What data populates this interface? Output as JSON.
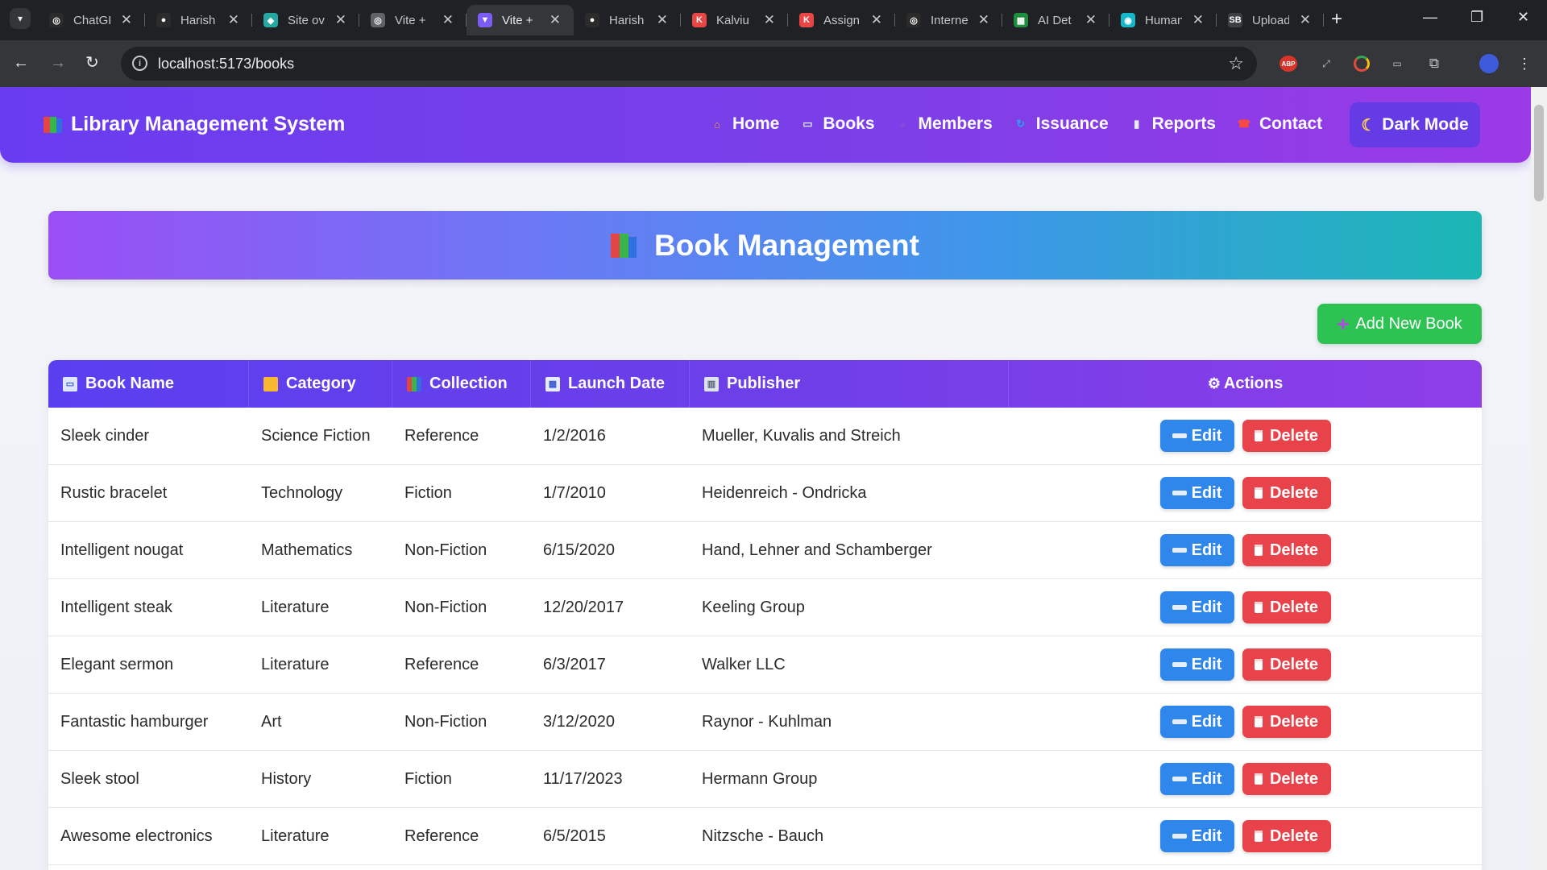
{
  "browser": {
    "tabs": [
      {
        "title": "ChatGPT",
        "favicon": "chatgpt-icon",
        "color": "#2b2b2b",
        "glyph": "◎",
        "active": false
      },
      {
        "title": "Harish",
        "favicon": "github-icon",
        "color": "#2b2b2b",
        "glyph": "●",
        "active": false
      },
      {
        "title": "Site ov",
        "favicon": "netlify-icon",
        "color": "#25a8a0",
        "glyph": "◆",
        "active": false
      },
      {
        "title": "Vite +",
        "favicon": "globe-icon",
        "color": "#5f6368",
        "glyph": "◎",
        "active": false
      },
      {
        "title": "Vite +",
        "favicon": "vite-icon",
        "color": "#7d5cf5",
        "glyph": "▼",
        "active": true
      },
      {
        "title": "Harish",
        "favicon": "github-icon",
        "color": "#2b2b2b",
        "glyph": "●",
        "active": false
      },
      {
        "title": "Kalviu",
        "favicon": "kalvium-icon",
        "color": "#e84545",
        "glyph": "K",
        "active": false
      },
      {
        "title": "Assign",
        "favicon": "kalvium-icon",
        "color": "#e84545",
        "glyph": "K",
        "active": false
      },
      {
        "title": "Interne",
        "favicon": "chatgpt-icon",
        "color": "#2b2b2b",
        "glyph": "◎",
        "active": false
      },
      {
        "title": "AI Det",
        "favicon": "sheets-icon",
        "color": "#1e8e3e",
        "glyph": "▦",
        "active": false
      },
      {
        "title": "Human",
        "favicon": "humanizer-icon",
        "color": "#14b8c8",
        "glyph": "◉",
        "active": false
      },
      {
        "title": "Upload",
        "favicon": "sb-icon",
        "color": "#3c4043",
        "glyph": "SB",
        "active": false
      }
    ],
    "url": "localhost:5173/books"
  },
  "navbar": {
    "brand": "Library Management System",
    "links": [
      {
        "label": "Home",
        "icon": "house-icon",
        "color": "#f29b3a"
      },
      {
        "label": "Books",
        "icon": "open-book-icon",
        "color": "#dfe7ff"
      },
      {
        "label": "Members",
        "icon": "people-icon",
        "color": "#8a4ad8"
      },
      {
        "label": "Issuance",
        "icon": "refresh-icon",
        "color": "#2aa3f0"
      },
      {
        "label": "Reports",
        "icon": "bar-chart-icon",
        "color": "#e8ecf0"
      },
      {
        "label": "Contact",
        "icon": "telephone-icon",
        "color": "#ff4a3a"
      }
    ],
    "dark_mode_label": "Dark Mode"
  },
  "page": {
    "title": "Book Management",
    "add_button_label": "Add New Book"
  },
  "table": {
    "headers": [
      {
        "label": "Book Name",
        "icon": "open-book-icon"
      },
      {
        "label": "Category",
        "icon": "folder-icon"
      },
      {
        "label": "Collection",
        "icon": "books-icon"
      },
      {
        "label": "Launch Date",
        "icon": "calendar-icon"
      },
      {
        "label": "Publisher",
        "icon": "building-icon"
      },
      {
        "label": "Actions",
        "icon": "gear-icon"
      }
    ],
    "edit_label": "Edit",
    "delete_label": "Delete",
    "rows": [
      [
        "Sleek cinder",
        "Science Fiction",
        "Reference",
        "1/2/2016",
        "Mueller, Kuvalis and Streich"
      ],
      [
        "Rustic bracelet",
        "Technology",
        "Fiction",
        "1/7/2010",
        "Heidenreich - Ondricka"
      ],
      [
        "Intelligent nougat",
        "Mathematics",
        "Non-Fiction",
        "6/15/2020",
        "Hand, Lehner and Schamberger"
      ],
      [
        "Intelligent steak",
        "Literature",
        "Non-Fiction",
        "12/20/2017",
        "Keeling Group"
      ],
      [
        "Elegant sermon",
        "Literature",
        "Reference",
        "6/3/2017",
        "Walker LLC"
      ],
      [
        "Fantastic hamburger",
        "Art",
        "Non-Fiction",
        "3/12/2020",
        "Raynor - Kuhlman"
      ],
      [
        "Sleek stool",
        "History",
        "Fiction",
        "11/17/2023",
        "Hermann Group"
      ],
      [
        "Awesome electronics",
        "Literature",
        "Reference",
        "6/5/2015",
        "Nitzsche - Bauch"
      ]
    ]
  }
}
